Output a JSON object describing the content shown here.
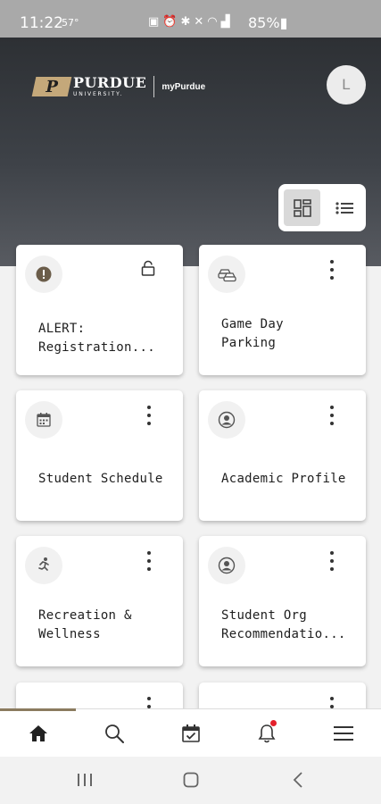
{
  "status_bar": {
    "time": "11:22",
    "temperature": "57°",
    "icons": [
      "battery-saver-icon",
      "alarm-icon",
      "bluetooth-icon",
      "mute-icon",
      "wifi-icon",
      "signal-icon"
    ],
    "battery": "85%"
  },
  "header": {
    "logo_word": "PURDUE",
    "logo_sub": "UNIVERSITY.",
    "app_name": "myPurdue",
    "avatar_initial": "L",
    "brand_color": "#c4a87a"
  },
  "view_toggle": {
    "active": "grid"
  },
  "cards": [
    {
      "title": "ALERT:\nRegistration...",
      "icon": "alert-icon",
      "action": "lock"
    },
    {
      "title": "Game Day\nParking",
      "icon": "parking-icon",
      "action": "menu"
    },
    {
      "title": "Student Schedule",
      "icon": "calendar-icon",
      "action": "menu"
    },
    {
      "title": "Academic Profile",
      "icon": "profile-icon",
      "action": "menu"
    },
    {
      "title": "Recreation &\nWellness",
      "icon": "running-icon",
      "action": "menu"
    },
    {
      "title": "Student Org\nRecommendatio...",
      "icon": "profile-icon",
      "action": "menu"
    }
  ],
  "bottom_nav": {
    "active": "home",
    "items": [
      "home-icon",
      "search-icon",
      "calendar-check-icon",
      "bell-icon",
      "menu-icon"
    ],
    "accent_color": "#8b7b5f",
    "notification_color": "#e4202b"
  }
}
